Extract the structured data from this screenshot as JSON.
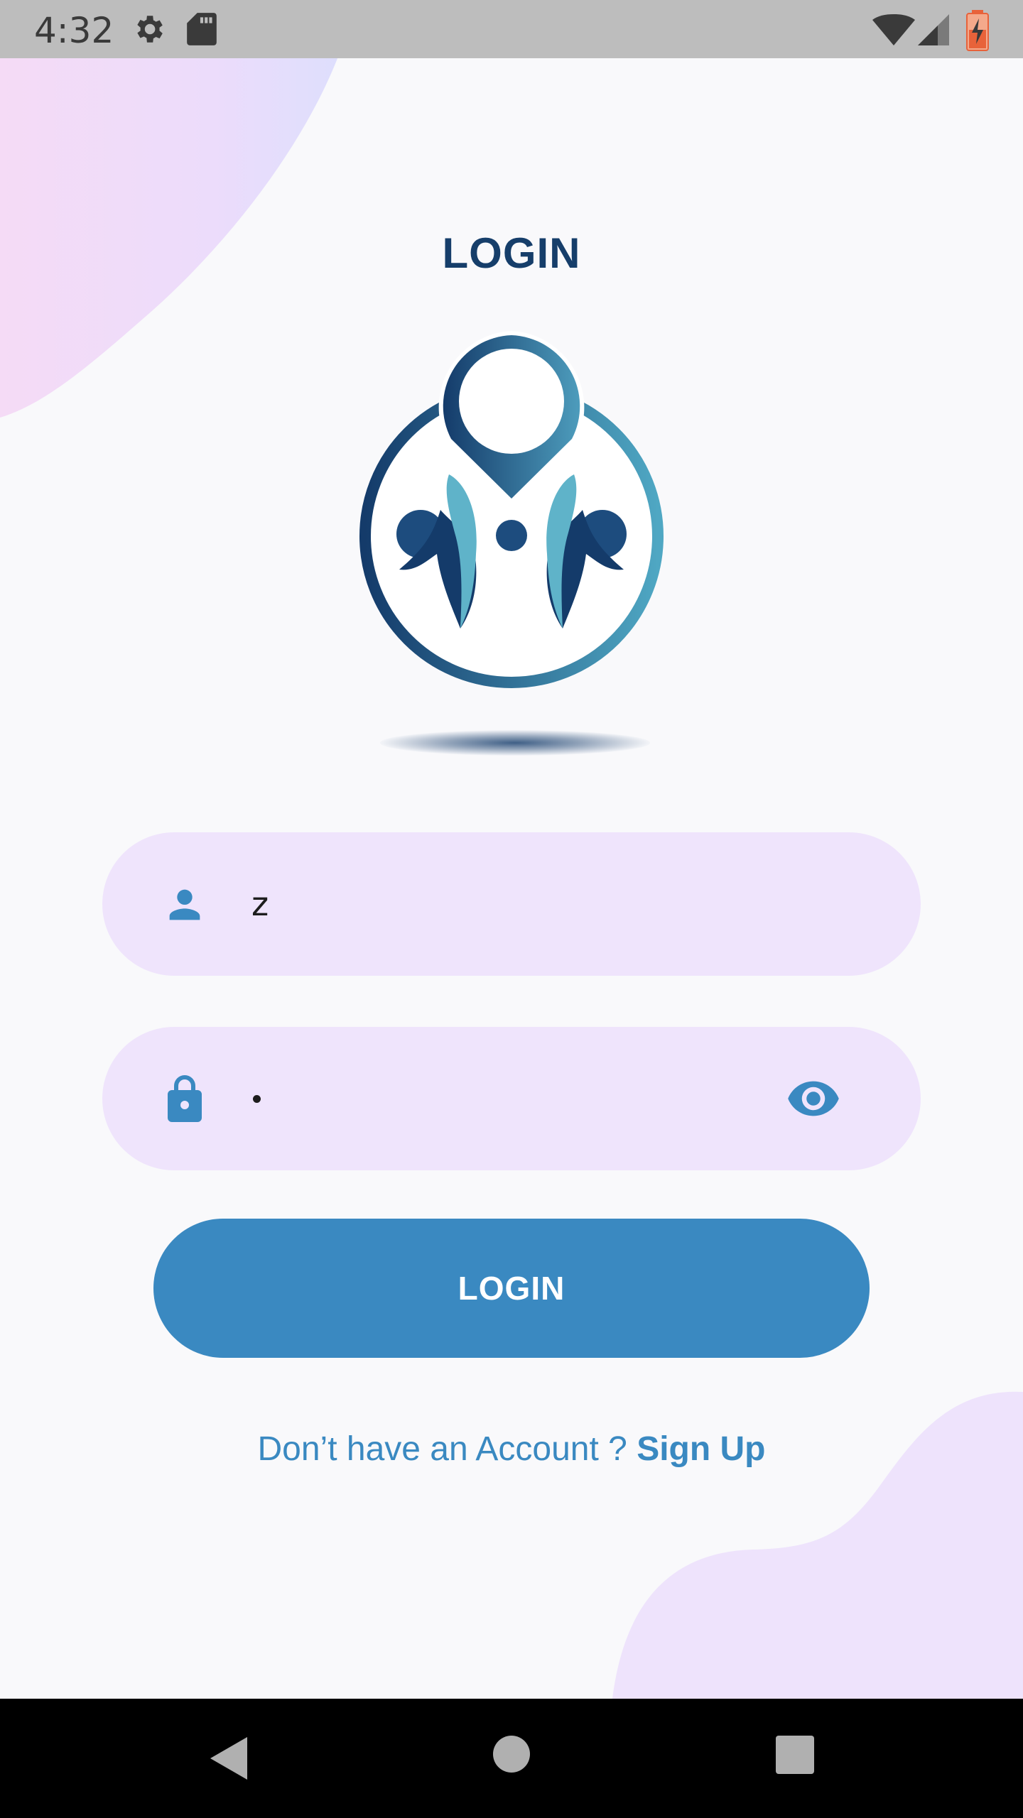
{
  "status_bar": {
    "time": "4:32",
    "left_icons": [
      "gear-icon",
      "sd-card-icon"
    ],
    "right_icons": [
      "wifi-icon",
      "cell-signal-icon",
      "battery-charging-icon"
    ]
  },
  "page": {
    "title": "LOGIN"
  },
  "username_field": {
    "icon": "person-icon",
    "value": "z"
  },
  "password_field": {
    "icon": "lock-icon",
    "masked_value": "•",
    "toggle_icon": "eye-icon"
  },
  "login_button": {
    "label": "LOGIN"
  },
  "signup": {
    "prompt": "Don’t have an Account ? ",
    "link_label": "Sign Up"
  },
  "nav_bar": {
    "buttons": [
      "back-icon",
      "home-icon",
      "recents-icon"
    ]
  },
  "colors": {
    "primary": "#3a89c1",
    "title": "#163e6a",
    "field_bg": "#efe4fc",
    "background": "#f9f9fb"
  }
}
